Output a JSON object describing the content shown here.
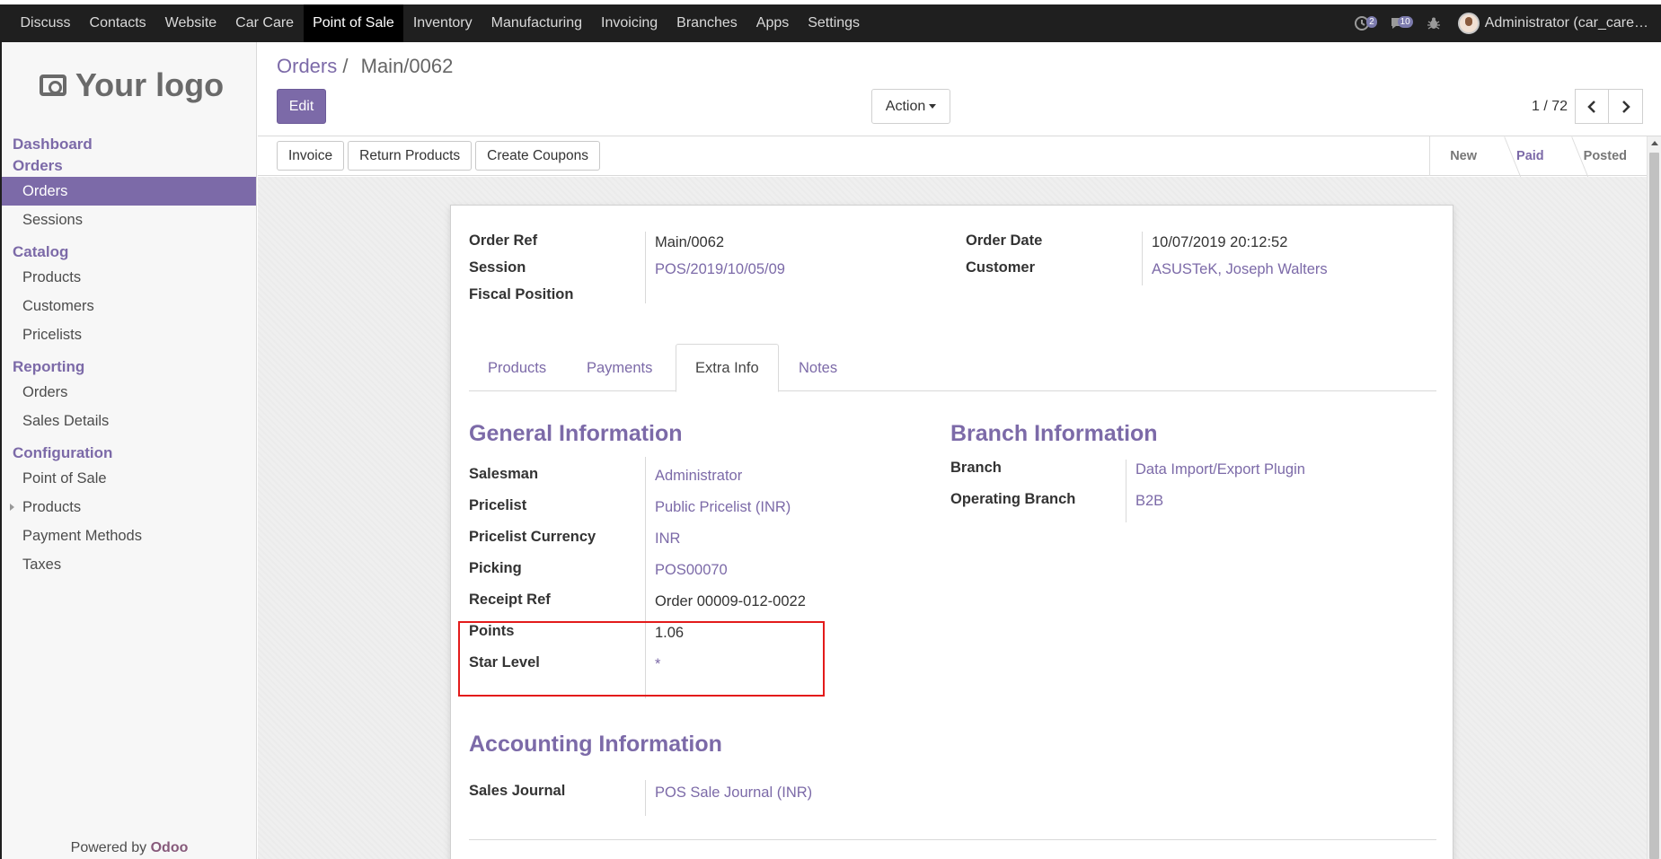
{
  "topbar": {
    "menu": [
      "Discuss",
      "Contacts",
      "Website",
      "Car Care",
      "Point of Sale",
      "Inventory",
      "Manufacturing",
      "Invoicing",
      "Branches",
      "Apps",
      "Settings"
    ],
    "active_menu": "Point of Sale",
    "activity_badge": "2",
    "messages_badge": "10",
    "user": "Administrator (car_care…"
  },
  "sidebar": {
    "logo_text": "Your logo",
    "sections": {
      "dashboard": "Dashboard",
      "orders": "Orders",
      "catalog": "Catalog",
      "reporting": "Reporting",
      "configuration": "Configuration"
    },
    "items": {
      "orders": "Orders",
      "sessions": "Sessions",
      "products": "Products",
      "customers": "Customers",
      "pricelists": "Pricelists",
      "rep_orders": "Orders",
      "sales_details": "Sales Details",
      "point_of_sale": "Point of Sale",
      "conf_products": "Products",
      "payment_methods": "Payment Methods",
      "taxes": "Taxes"
    },
    "powered_by": "Powered by",
    "powered_brand": "Odoo"
  },
  "control": {
    "breadcrumb_parent": "Orders",
    "breadcrumb_sep": "/",
    "breadcrumb_current": "Main/0062",
    "edit_label": "Edit",
    "action_label": "Action",
    "pager_value": "1 / 72"
  },
  "statusbar": {
    "buttons": [
      "Invoice",
      "Return Products",
      "Create Coupons"
    ],
    "stages": [
      "New",
      "Paid",
      "Posted"
    ],
    "current_stage": "Paid"
  },
  "header_fields": {
    "order_ref_label": "Order Ref",
    "order_ref_value": "Main/0062",
    "session_label": "Session",
    "session_value": "POS/2019/10/05/09",
    "fiscal_position_label": "Fiscal Position",
    "order_date_label": "Order Date",
    "order_date_value": "10/07/2019 20:12:52",
    "customer_label": "Customer",
    "customer_value": "ASUSTeK, Joseph Walters"
  },
  "tabs": [
    "Products",
    "Payments",
    "Extra Info",
    "Notes"
  ],
  "active_tab": "Extra Info",
  "general": {
    "title": "General Information",
    "salesman_label": "Salesman",
    "salesman_value": "Administrator",
    "pricelist_label": "Pricelist",
    "pricelist_value": "Public Pricelist (INR)",
    "currency_label": "Pricelist Currency",
    "currency_value": "INR",
    "picking_label": "Picking",
    "picking_value": "POS00070",
    "receipt_label": "Receipt Ref",
    "receipt_value": "Order 00009-012-0022",
    "points_label": "Points",
    "points_value": "1.06",
    "star_label": "Star Level",
    "star_value": "*"
  },
  "branch": {
    "title": "Branch Information",
    "branch_label": "Branch",
    "branch_value": "Data Import/Export Plugin",
    "operating_label": "Operating Branch",
    "operating_value": "B2B"
  },
  "accounting": {
    "title": "Accounting Information",
    "journal_label": "Sales Journal",
    "journal_value": "POS Sale Journal (INR)"
  },
  "colors": {
    "accent": "#7c6aa8",
    "topbar": "#1f1f1f",
    "highlight": "#e31b1b"
  }
}
